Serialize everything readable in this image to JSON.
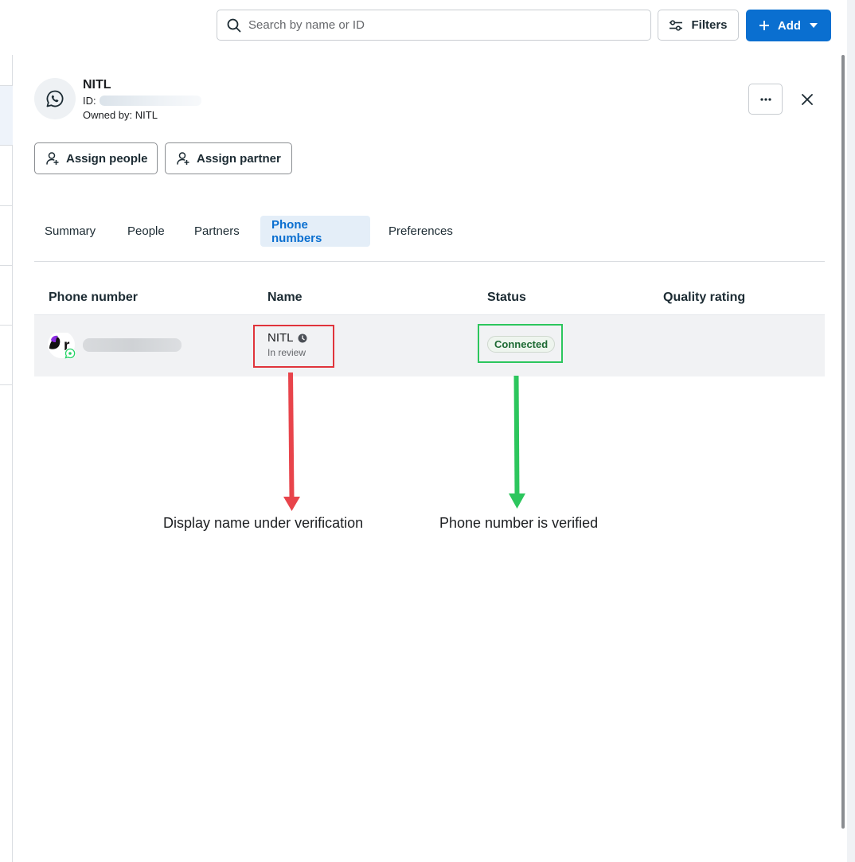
{
  "topbar": {
    "search_placeholder": "Search by name or ID",
    "filters_label": "Filters",
    "add_label": "Add"
  },
  "account": {
    "name": "NITL",
    "id_label": "ID:",
    "owner": "Owned by: NITL"
  },
  "actions": {
    "assign_people": "Assign people",
    "assign_partner": "Assign partner",
    "more_icon": "ellipsis-icon",
    "close_icon": "close-icon"
  },
  "tabs": [
    {
      "label": "Summary",
      "active": false
    },
    {
      "label": "People",
      "active": false
    },
    {
      "label": "Partners",
      "active": false
    },
    {
      "label": "Phone numbers",
      "active": true
    },
    {
      "label": "Preferences",
      "active": false
    }
  ],
  "table": {
    "columns": [
      "Phone number",
      "Name",
      "Status",
      "Quality rating"
    ],
    "rows": [
      {
        "name": "NITL",
        "name_status": "In review",
        "status": "Connected",
        "quality_rating": ""
      }
    ]
  },
  "annotations": {
    "left": "Display name under verification",
    "right": "Phone number is verified"
  },
  "colors": {
    "accent": "#0a6fd0",
    "annotation_red": "#e0343b",
    "annotation_green": "#2cc65d",
    "status_green": "#1e6b34"
  }
}
